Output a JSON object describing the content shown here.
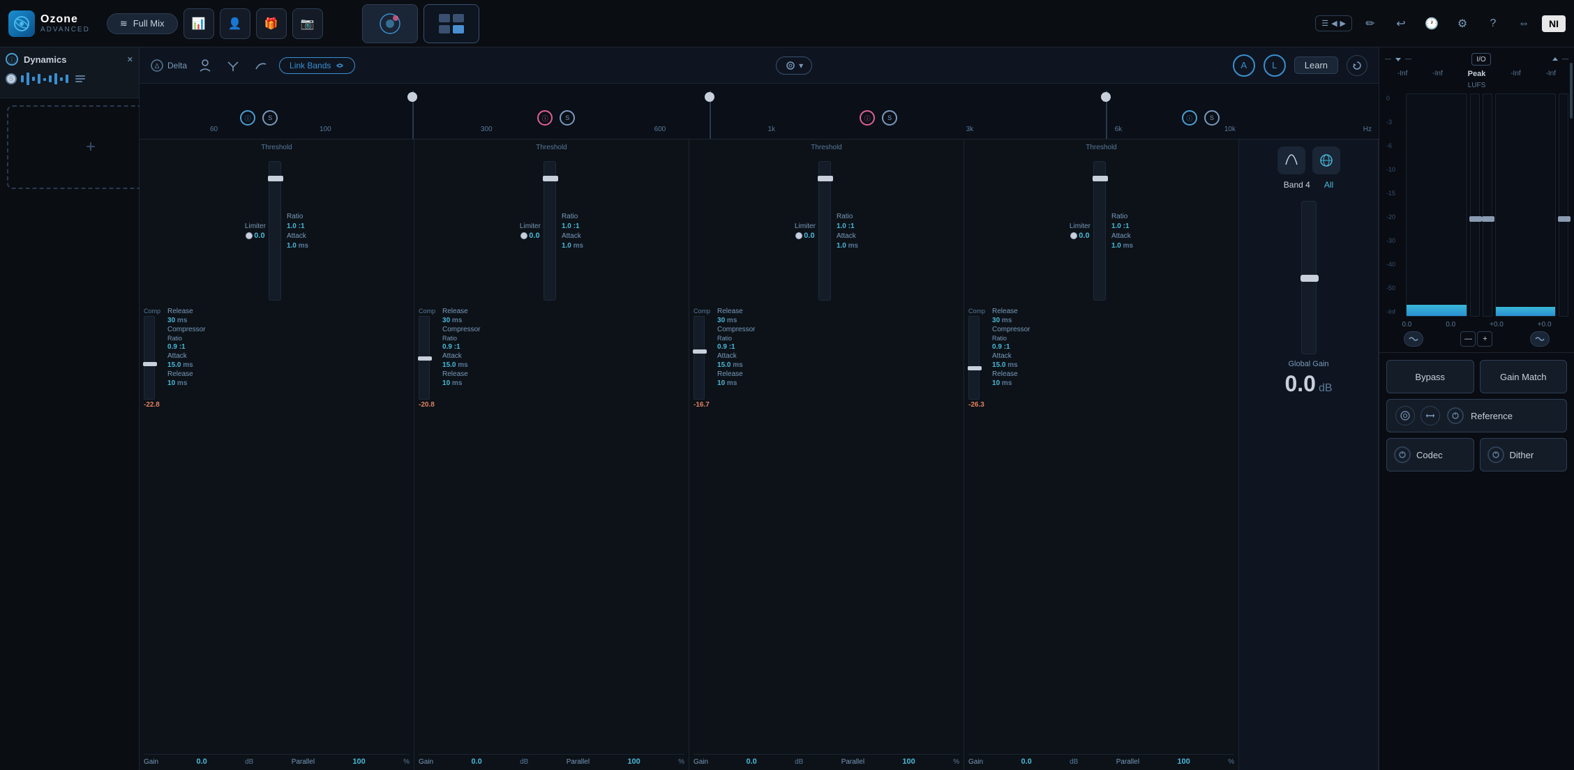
{
  "app": {
    "name": "Ozone",
    "sub": "ADVANCED",
    "version": "Advanced"
  },
  "top_bar": {
    "full_mix_label": "Full Mix",
    "icons": [
      "waveform",
      "person",
      "gift",
      "camera"
    ],
    "right_icons": [
      "pencil",
      "undo",
      "history",
      "gear",
      "question",
      "arrows",
      "NI"
    ]
  },
  "toolbar": {
    "delta_label": "Delta",
    "link_bands_label": "Link Bands",
    "ab_a_label": "A",
    "ab_l_label": "L",
    "learn_label": "Learn"
  },
  "freq_labels": [
    "60",
    "100",
    "300",
    "600",
    "1k",
    "3k",
    "6k",
    "10k",
    "Hz"
  ],
  "bands": [
    {
      "id": 1,
      "threshold_label": "Threshold",
      "limiter_label": "Limiter",
      "limiter_value": "0.0",
      "ratio_label": "Ratio",
      "ratio_value": "1.0",
      "ratio_unit": ":1",
      "attack_label": "Attack",
      "attack_value": "1.0",
      "attack_unit": "ms",
      "comp_label": "Comp",
      "comp_value": "-22.8",
      "release_label": "Release",
      "release_value": "30",
      "release_unit": "ms",
      "comp_ratio_label": "Compressor",
      "comp_ratio_sub": "Ratio",
      "comp_ratio_value": "0.9",
      "comp_ratio_unit": ":1",
      "comp_attack_label": "Attack",
      "comp_attack_value": "15.0",
      "comp_attack_unit": "ms",
      "comp_release_label": "Release",
      "comp_release_value": "10",
      "comp_release_unit": "ms",
      "gain_label": "Gain",
      "gain_value": "0.0",
      "gain_unit": "dB",
      "parallel_label": "Parallel",
      "parallel_value": "100",
      "parallel_unit": "%"
    },
    {
      "id": 2,
      "threshold_label": "Threshold",
      "limiter_label": "Limiter",
      "limiter_value": "0.0",
      "ratio_label": "Ratio",
      "ratio_value": "1.0",
      "ratio_unit": ":1",
      "attack_label": "Attack",
      "attack_value": "1.0",
      "attack_unit": "ms",
      "comp_label": "Comp",
      "comp_value": "-20.8",
      "release_label": "Release",
      "release_value": "30",
      "release_unit": "ms",
      "comp_ratio_value": "0.9",
      "comp_ratio_unit": ":1",
      "comp_attack_value": "15.0",
      "comp_attack_unit": "ms",
      "comp_release_value": "10",
      "comp_release_unit": "ms",
      "gain_value": "0.0",
      "gain_unit": "dB",
      "parallel_value": "100",
      "parallel_unit": "%"
    },
    {
      "id": 3,
      "threshold_label": "Threshold",
      "limiter_value": "0.0",
      "ratio_value": "1.0",
      "ratio_unit": ":1",
      "attack_value": "1.0",
      "attack_unit": "ms",
      "comp_value": "-16.7",
      "release_value": "30",
      "release_unit": "ms",
      "comp_ratio_value": "0.9",
      "comp_ratio_unit": ":1",
      "comp_attack_value": "15.0",
      "comp_attack_unit": "ms",
      "comp_release_value": "10",
      "comp_release_unit": "ms",
      "gain_value": "0.0",
      "gain_unit": "dB",
      "parallel_value": "100",
      "parallel_unit": "%"
    },
    {
      "id": 4,
      "threshold_label": "Threshold",
      "limiter_value": "0.0",
      "ratio_value": "1.0",
      "ratio_unit": ":1",
      "attack_value": "1.0",
      "attack_unit": "ms",
      "comp_value": "-26.3",
      "release_value": "30",
      "release_unit": "ms",
      "comp_ratio_value": "0.9",
      "comp_ratio_unit": ":1",
      "comp_attack_value": "15.0",
      "comp_attack_unit": "ms",
      "comp_release_value": "10",
      "comp_release_unit": "ms",
      "gain_value": "0.0",
      "gain_unit": "dB",
      "parallel_value": "100",
      "parallel_unit": "%"
    }
  ],
  "band4_section": {
    "band_label": "Band 4",
    "all_label": "All",
    "global_gain_label": "Global Gain",
    "global_gain_value": "0.0",
    "global_gain_unit": "dB"
  },
  "dynamics_module": {
    "name": "Dynamics",
    "power_on": true
  },
  "right_panel": {
    "io_label": "I/O",
    "peak_label": "Peak",
    "lufs_label": "LUFS",
    "neg_inf": "-Inf",
    "meter_scale": [
      "0",
      "-3",
      "-6",
      "-10",
      "-15",
      "-20",
      "-30",
      "-40",
      "-50",
      "-Inf"
    ],
    "fader_values": [
      "0.0",
      "0.0",
      "+0.0",
      "+0.0"
    ],
    "bypass_label": "Bypass",
    "gain_match_label": "Gain Match",
    "reference_label": "Reference",
    "codec_label": "Codec",
    "dither_label": "Dither"
  }
}
